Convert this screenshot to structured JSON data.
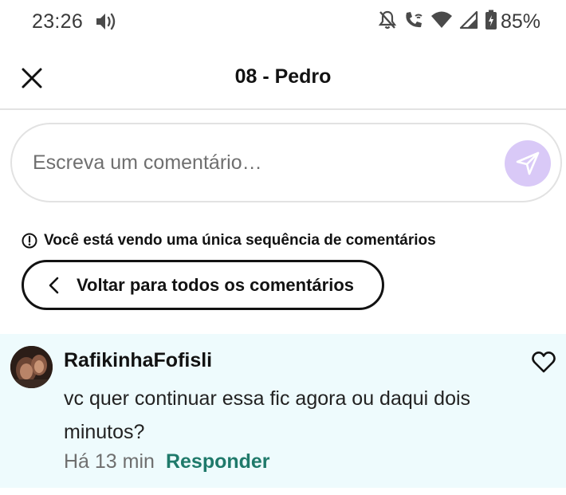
{
  "status_bar": {
    "time": "23:26",
    "battery_percent": "85%",
    "icons": [
      "volume-icon",
      "notifications-off-icon",
      "wifi-calling-icon",
      "wifi-icon",
      "cellular-signal-icon",
      "battery-charging-icon"
    ]
  },
  "header": {
    "title": "08 - Pedro",
    "close_icon": "close-icon"
  },
  "comment_input": {
    "placeholder": "Escreva um comentário…",
    "value": "",
    "send_icon": "send-icon",
    "send_color": "#d9c9f7"
  },
  "thread_notice": {
    "icon": "info-icon",
    "text": "Você está vendo uma única sequência de comentários"
  },
  "back_button": {
    "icon": "chevron-left-icon",
    "label": "Voltar para todos os comentários"
  },
  "comment": {
    "author": "RafikinhaFofisli",
    "text": "vc quer continuar essa fic agora ou daqui dois minutos?",
    "time": "Há 13 min",
    "reply_label": "Responder",
    "like_icon": "heart-outline-icon",
    "background_color": "#eefbfd",
    "reply_color": "#1f7a6b"
  }
}
